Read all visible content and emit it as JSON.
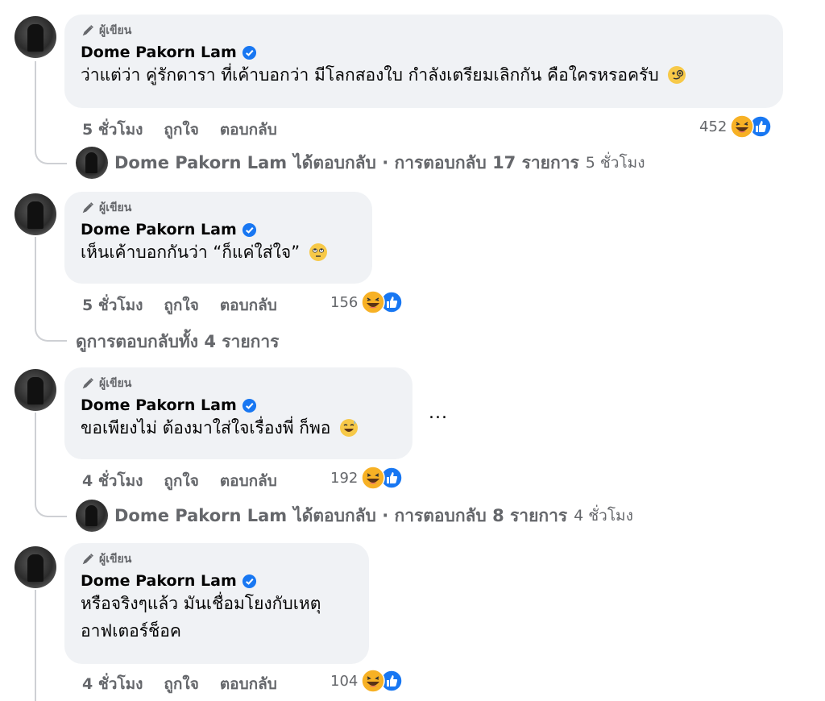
{
  "comments": [
    {
      "badge": "ผู้เขียน",
      "name": "Dome Pakorn Lam",
      "text": "ว่าแต่ว่า คู่รักดารา ที่เค้าบอกว่า มีโลกสองใบ กำลังเตรียมเลิกกัน คือใครหรอครับ",
      "emoji": "monocle-face-emoji",
      "time": "5 ชั่วโมง",
      "like": "ถูกใจ",
      "reply": "ตอบกลับ",
      "reactions": "452"
    },
    {
      "badge": "ผู้เขียน",
      "name": "Dome Pakorn Lam",
      "text": "เห็นเค้าบอกกันว่า “ก็แค่ใส่ใจ”",
      "emoji": "rolling-eyes-emoji",
      "time": "5 ชั่วโมง",
      "like": "ถูกใจ",
      "reply": "ตอบกลับ",
      "reactions": "156"
    },
    {
      "badge": "ผู้เขียน",
      "name": "Dome Pakorn Lam",
      "text": "ขอเพียงไม่ ต้องมาใส่ใจเรื่องพี่ ก็พอ",
      "emoji": "grinning-sweat-emoji",
      "time": "4 ชั่วโมง",
      "like": "ถูกใจ",
      "reply": "ตอบกลับ",
      "reactions": "192",
      "more": "..."
    },
    {
      "badge": "ผู้เขียน",
      "name": "Dome Pakorn Lam",
      "text_line1": "หรือจริงๆแล้ว มันเชื่อมโยงกับเหตุ",
      "text_line2": "อาฟเตอร์ช็อค",
      "time": "4 ชั่วโมง",
      "like": "ถูกใจ",
      "reply": "ตอบกลับ",
      "reactions": "104"
    }
  ],
  "replies": [
    {
      "name": "Dome Pakorn Lam",
      "action": "ได้ตอบกลับ · การตอบกลับ 17 รายการ",
      "time": "5 ชั่วโมง"
    },
    {
      "view_all": "ดูการตอบกลับทั้ง 4 รายการ"
    },
    {
      "name": "Dome Pakorn Lam",
      "action": "ได้ตอบกลับ · การตอบกลับ 8 รายการ",
      "time": "4 ชั่วโมง"
    }
  ],
  "colors": {
    "bubble": "#f0f2f5",
    "meta_text": "#65676b",
    "verified": "#1877f2",
    "like_blue": "#1877f2",
    "haha_yellow": "#f7b125"
  },
  "icons": {
    "author_badge": "pencil-mic-icon",
    "verified": "verified-badge-icon",
    "haha": "haha-reaction-icon",
    "like": "like-reaction-icon"
  }
}
